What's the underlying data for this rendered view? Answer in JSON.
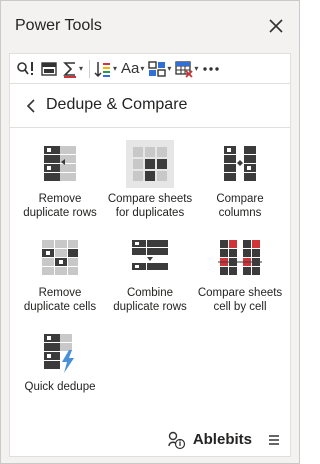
{
  "window": {
    "title": "Power Tools"
  },
  "toolbar": {
    "buttons": [
      {
        "icon": "search-replace-icon"
      },
      {
        "icon": "chart-icon"
      },
      {
        "icon": "sum-icon",
        "has_menu": true
      },
      {
        "icon": "sort-icon",
        "has_menu": true
      },
      {
        "icon": "text-case-icon",
        "label": "Aa",
        "has_menu": true
      },
      {
        "icon": "merge-cells-icon",
        "has_menu": true
      },
      {
        "icon": "clear-table-icon",
        "has_menu": true
      },
      {
        "icon": "more-icon"
      }
    ]
  },
  "header": {
    "title": "Dedupe & Compare"
  },
  "tools": [
    {
      "label": "Remove\nduplicate rows",
      "icon": "remove-duplicate-rows-icon"
    },
    {
      "label": "Compare sheets\nfor duplicates",
      "icon": "compare-sheets-icon",
      "selected": true
    },
    {
      "label": "Compare\ncolumns",
      "icon": "compare-columns-icon"
    },
    {
      "label": "Remove\nduplicate cells",
      "icon": "remove-duplicate-cells-icon"
    },
    {
      "label": "Combine\nduplicate rows",
      "icon": "combine-duplicate-rows-icon"
    },
    {
      "label": "Compare sheets\ncell by cell",
      "icon": "compare-cell-by-cell-icon"
    },
    {
      "label": "Quick dedupe",
      "icon": "quick-dedupe-icon"
    }
  ],
  "footer": {
    "brand": "Ablebits"
  },
  "colors": {
    "accent": "#d13438",
    "dark": "#3b3b3b",
    "light": "#c8c8c8",
    "bolt": "#4a90d9"
  }
}
